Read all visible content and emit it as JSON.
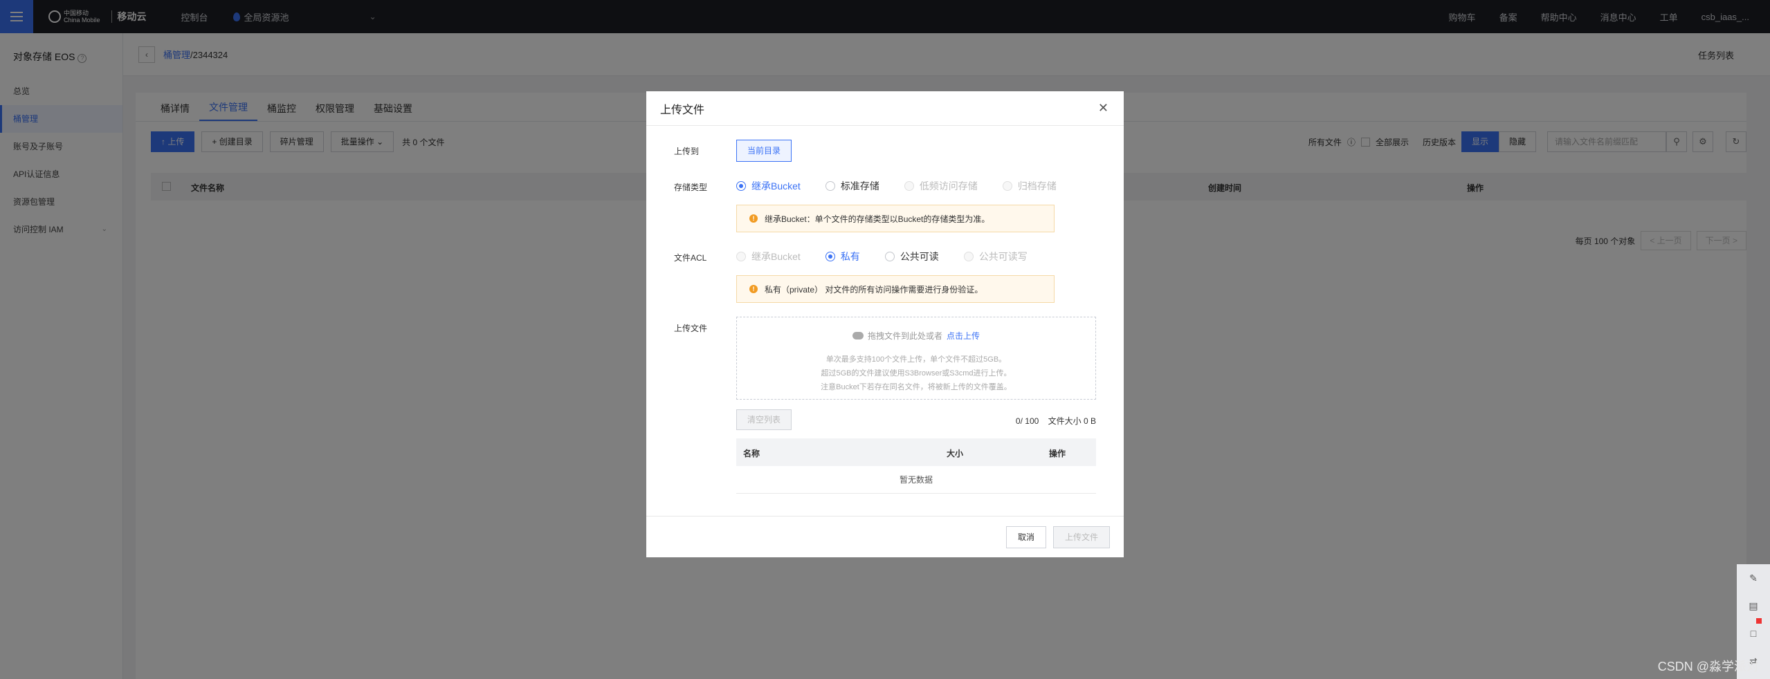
{
  "topbar": {
    "logo_cn": "中国移动",
    "logo_en": "China Mobile",
    "logo_cloud": "移动云",
    "console": "控制台",
    "region": "全局资源池",
    "links": [
      "购物车",
      "备案",
      "帮助中心",
      "消息中心",
      "工单"
    ],
    "user": "csb_iaas_..."
  },
  "sidebar": {
    "title": "对象存储 EOS",
    "items": [
      {
        "label": "总览"
      },
      {
        "label": "桶管理"
      },
      {
        "label": "账号及子账号"
      },
      {
        "label": "API认证信息"
      },
      {
        "label": "资源包管理"
      },
      {
        "label": "访问控制 IAM"
      }
    ]
  },
  "breadcrumb": {
    "parent": "桶管理",
    "separator": "/",
    "current": "2344324"
  },
  "task_list": "任务列表",
  "tabs": [
    "桶详情",
    "文件管理",
    "桶监控",
    "权限管理",
    "基础设置"
  ],
  "toolbar": {
    "upload": "上传",
    "create_dir": "创建目录",
    "fragment": "碎片管理",
    "batch": "批量操作",
    "count": "共 0 个文件",
    "all_files": "所有文件",
    "show_all": "全部展示",
    "history": "历史版本",
    "show": "显示",
    "hide": "隐藏",
    "search_placeholder": "请输入文件名前缀匹配"
  },
  "table_header": {
    "name": "文件名称",
    "created": "创建时间",
    "actions": "操作"
  },
  "pager": {
    "per_page": "每页 100 个对象",
    "prev": "< 上一页",
    "next": "下一页 >"
  },
  "modal": {
    "title": "上传文件",
    "upload_to_label": "上传到",
    "upload_to_value": "当前目录",
    "storage_type_label": "存储类型",
    "storage_options": [
      "继承Bucket",
      "标准存储",
      "低频访问存储",
      "归档存储"
    ],
    "storage_notice": "继承Bucket：单个文件的存储类型以Bucket的存储类型为准。",
    "acl_label": "文件ACL",
    "acl_options": [
      "继承Bucket",
      "私有",
      "公共可读",
      "公共可读写"
    ],
    "acl_notice": "私有（private） 对文件的所有访问操作需要进行身份验证。",
    "upload_file_label": "上传文件",
    "dropzone_text": "拖拽文件到此处或者",
    "dropzone_link": "点击上传",
    "hints": [
      "单次最多支持100个文件上传，单个文件不超过5GB。",
      "超过5GB的文件建议使用S3Browser或S3cmd进行上传。",
      "注意Bucket下若存在同名文件，将被新上传的文件覆盖。"
    ],
    "clear_list": "清空列表",
    "count": "0/ 100",
    "size": "文件大小 0 B",
    "table_cols": [
      "名称",
      "大小",
      "操作"
    ],
    "empty": "暂无数据",
    "cancel": "取消",
    "submit": "上传文件"
  },
  "watermark": "CSDN @淼学派对",
  "colors": {
    "primary": "#3b72f5",
    "topbar": "#1d1f25",
    "warning": "#f19b22"
  }
}
